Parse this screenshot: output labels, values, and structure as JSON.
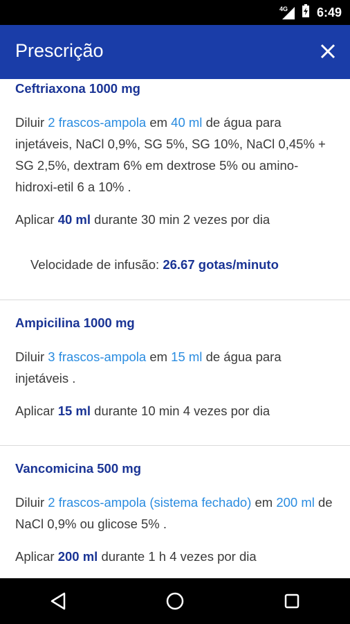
{
  "status": {
    "network": "4G",
    "time": "6:49"
  },
  "appbar": {
    "title": "Prescrição"
  },
  "items": [
    {
      "title": "Ceftriaxona 1000 mg",
      "dilute_prefix": "Diluir",
      "vials": "2 frascos-ampola",
      "in_word": "em",
      "volume": "40 ml",
      "solvent": "de água para injetáveis, NaCl 0,9%, SG 5%, SG 10%, NaCl 0,45% + SG 2,5%, dextram 6% em dextrose 5% ou amino-hidroxi-etil 6 a 10% .",
      "apply_prefix": "Aplicar",
      "apply_volume": "40 ml",
      "apply_suffix": "durante 30 min 2 vezes por dia",
      "infusion_label": "Velocidade de infusão:",
      "infusion_value": "26.67 gotas/minuto"
    },
    {
      "title": "Ampicilina 1000 mg",
      "dilute_prefix": "Diluir",
      "vials": "3 frascos-ampola",
      "in_word": "em",
      "volume": "15 ml",
      "solvent": "de água para injetáveis .",
      "apply_prefix": "Aplicar",
      "apply_volume": "15 ml",
      "apply_suffix": "durante 10 min 4 vezes por dia"
    },
    {
      "title": "Vancomicina 500 mg",
      "dilute_prefix": "Diluir",
      "vials": "2 frascos-ampola (sistema fechado)",
      "in_word": "em",
      "volume": "200 ml",
      "solvent": "de NaCl 0,9% ou glicose 5% .",
      "apply_prefix": "Aplicar",
      "apply_volume": "200 ml",
      "apply_suffix": "durante 1 h 4 vezes por dia"
    }
  ],
  "nav": {
    "back_icon": "back-triangle-icon",
    "home_icon": "home-circle-icon",
    "recents_icon": "recents-square-icon"
  },
  "colors": {
    "appbar": "#1a3da8",
    "title_blue": "#1a3495",
    "link_blue": "#2a8ce0"
  }
}
